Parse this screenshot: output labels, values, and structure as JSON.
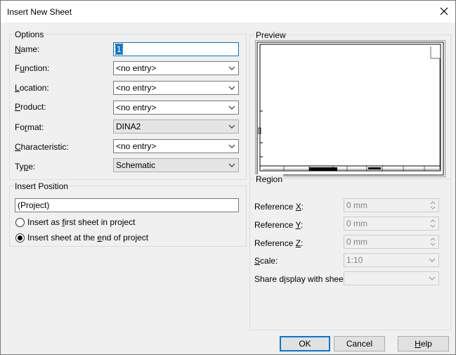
{
  "window": {
    "title": "Insert New Sheet"
  },
  "options": {
    "legend": "Options",
    "name": {
      "label": "Name:",
      "value": "1"
    },
    "function": {
      "label": "Function:",
      "value": "<no entry>"
    },
    "location": {
      "label": "Location:",
      "value": "<no entry>"
    },
    "product": {
      "label": "Product:",
      "value": "<no entry>"
    },
    "format": {
      "label": "Format:",
      "value": "DINA2"
    },
    "characteristic": {
      "label": "Characteristic:",
      "value": "<no entry>"
    },
    "type": {
      "label": "Type:",
      "value": "Schematic"
    }
  },
  "insert_position": {
    "legend": "Insert Position",
    "value": "(Project)",
    "option_first": "Insert as first sheet in project",
    "option_end": "Insert sheet at the end of project",
    "selected": "end"
  },
  "preview": {
    "legend": "Preview"
  },
  "region": {
    "legend": "Region",
    "ref_x": {
      "label": "Reference X:",
      "value": "0 mm"
    },
    "ref_y": {
      "label": "Reference Y:",
      "value": "0 mm"
    },
    "ref_z": {
      "label": "Reference Z:",
      "value": "0 mm"
    },
    "scale": {
      "label": "Scale:",
      "value": "1:10"
    },
    "share": {
      "label": "Share display with sheet:",
      "value": ""
    }
  },
  "buttons": {
    "ok": "OK",
    "cancel": "Cancel",
    "help": "Help"
  },
  "icons": {
    "close": "close-icon",
    "dropdown": "chevron-down-icon",
    "spin": "spin-updown-icon"
  },
  "colors": {
    "accent": "#0078d7",
    "dialog_bg": "#f0f0f0"
  }
}
